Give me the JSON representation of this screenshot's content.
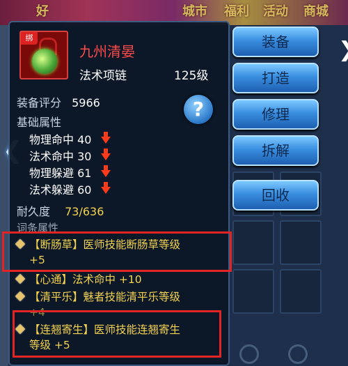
{
  "background": {
    "top_menu": [
      "好",
      "城市",
      "福利",
      "活动",
      "商城"
    ]
  },
  "item": {
    "bound_tag": "绑",
    "name": "九州清晏",
    "type": "法术项链",
    "level": "125级",
    "icon": "green-orb-necklace-icon"
  },
  "stats": {
    "score_label": "装备评分",
    "score_value": "5966",
    "base_attr_label": "基础属性",
    "base_attrs": [
      {
        "name": "物理命中",
        "value": "40"
      },
      {
        "name": "法术命中",
        "value": "30"
      },
      {
        "name": "物理躲避",
        "value": "61"
      },
      {
        "name": "法术躲避",
        "value": "60"
      }
    ],
    "durability_label": "耐久度",
    "durability_value": "73/636",
    "affix_label": "词条属性"
  },
  "effects": [
    {
      "line1": "【断肠草】医师技能断肠草等级",
      "line2": "+5"
    },
    {
      "line1": "【心通】法术命中 +10",
      "line2": ""
    },
    {
      "line1": "【清平乐】魅者技能清平乐等级",
      "line2": "+4"
    },
    {
      "line1": "【连翘寄生】医师技能连翘寄生",
      "line2": "等级 +5"
    }
  ],
  "menu": {
    "equip": "装备",
    "forge": "打造",
    "repair": "修理",
    "dismantle": "拆解",
    "recycle": "回收"
  },
  "help_label": "?",
  "colors": {
    "item_name": "#ff4a4a",
    "highlight_box": "#e32424",
    "effect_text": "#f3d350",
    "stat_down": "#ff3a1a"
  }
}
